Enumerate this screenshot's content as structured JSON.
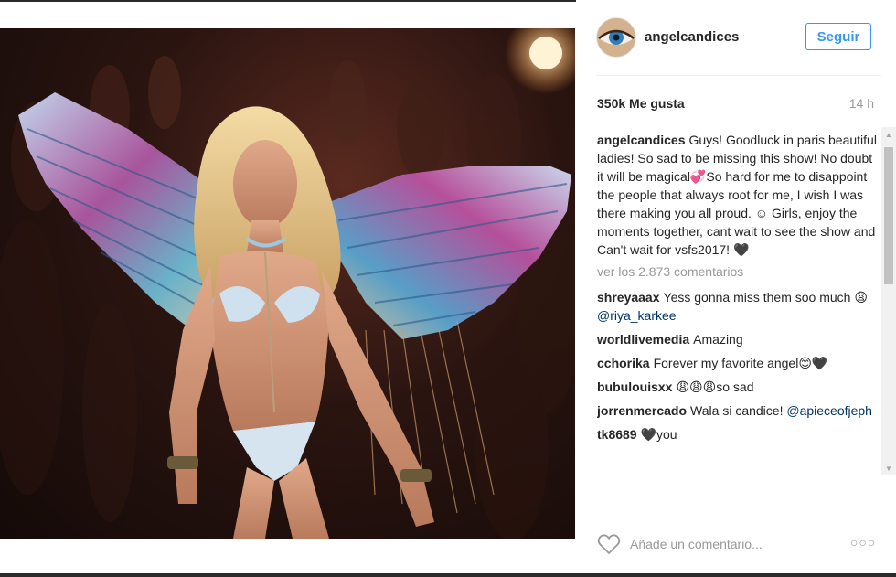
{
  "post": {
    "username": "angelcandices",
    "follow_label": "Seguir",
    "likes": "350k Me gusta",
    "time": "14 h",
    "caption": {
      "user": "angelcandices",
      "text": "Guys! Goodluck in paris beautiful ladies! So sad to be missing this show! No doubt it will be magical💞So hard for me to disappoint the people that always root for me, I wish I was there making you all proud. ☺ Girls, enjoy the moments together, cant wait to see the show and Can't wait for vsfs2017! 🖤"
    },
    "load_more": "ver los 2.873 comentarios",
    "comments": [
      {
        "user": "shreyaaax",
        "text": "Yess gonna miss them soo much 😩 ",
        "mention": "@riya_karkee"
      },
      {
        "user": "worldlivemedia",
        "text": "Amazing",
        "mention": ""
      },
      {
        "user": "cchorika",
        "text": "Forever my favorite angel😊🖤",
        "mention": ""
      },
      {
        "user": "bubulouisxx",
        "text": "😩😩😩so sad",
        "mention": ""
      },
      {
        "user": "jorrenmercado",
        "text": "Wala si candice! ",
        "mention": "@apieceofjeph"
      },
      {
        "user": "tk8689",
        "text": "🖤you",
        "mention": ""
      }
    ],
    "add_comment_placeholder": "Añade un comentario...",
    "more_label": "○○○"
  },
  "icons": {
    "heart": "heart-outline-icon",
    "more": "more-options-icon",
    "scroll_up": "scroll-up-arrow-icon",
    "scroll_down": "scroll-down-arrow-icon"
  },
  "colors": {
    "accent": "#3897f0",
    "mention": "#003569",
    "muted": "#999999"
  }
}
